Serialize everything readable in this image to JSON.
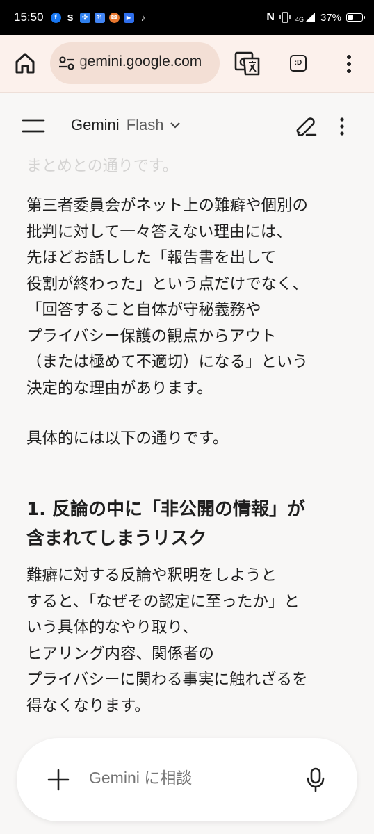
{
  "status_bar": {
    "time": "15:50",
    "notification_icons": [
      {
        "name": "facebook-icon",
        "glyph": "f",
        "color": "#1877f2"
      },
      {
        "name": "s-app-icon",
        "glyph": "S",
        "color": "#000000"
      },
      {
        "name": "puzzle-app-icon",
        "glyph": "✣",
        "color": "#2f80ed"
      },
      {
        "name": "calendar-icon",
        "glyph": "31",
        "color": "#4285f4"
      },
      {
        "name": "mail-app-icon",
        "glyph": "✉",
        "color": "#e8772e"
      },
      {
        "name": "youtube-icon",
        "glyph": "▶",
        "color": "#2f6fed"
      },
      {
        "name": "tiktok-icon",
        "glyph": "♪",
        "color": "#000000"
      }
    ],
    "nfc_label": "N",
    "network": "4G",
    "battery": "37%"
  },
  "browser": {
    "url": "gemini.google.com",
    "extension_label": ":D"
  },
  "app_bar": {
    "title": "Gemini",
    "model": "Flash"
  },
  "conversation": {
    "faded_line": "まとめとの通りです。",
    "paragraph1": [
      "第三者委員会がネット上の難癖や個別の",
      "批判に対して一々答えない理由には、",
      "先ほどお話しした「報告書を出して",
      "役割が終わった」という点だけでなく、",
      "「回答すること自体が守秘義務や",
      "プライバシー保護の観点からアウト",
      "（または極めて不適切）になる」という",
      "決定的な理由があります。"
    ],
    "paragraph2": "具体的には以下の通りです。",
    "heading1": [
      "1. 反論の中に「非公開の情報」が",
      "含まれてしまうリスク"
    ],
    "paragraph3": [
      "難癖に対する反論や釈明をしようと",
      "すると、「なぜその認定に至ったか」と",
      "いう具体的なやり取り、",
      "ヒアリング内容、関係者の",
      "プライバシーに関わる事実に触れざるを",
      "得なくなります。"
    ]
  },
  "composer": {
    "placeholder": "Gemini に相談"
  }
}
